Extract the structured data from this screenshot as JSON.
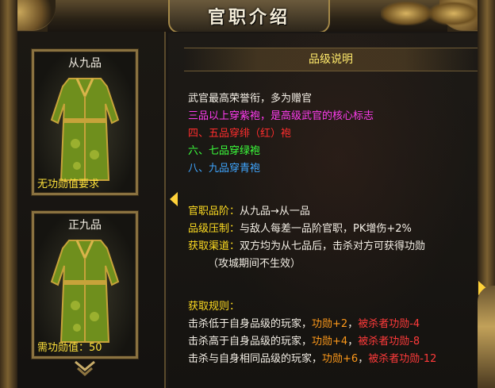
{
  "window": {
    "title": "官职介绍"
  },
  "ranks": [
    {
      "name": "从九品",
      "requirement": "无功勋值要求"
    },
    {
      "name": "正九品",
      "requirement": "需功勋值：50"
    }
  ],
  "panel": {
    "header": "品级说明",
    "desc_lines": [
      "武官最高荣誉衔，多为赠官",
      "三品以上穿紫袍，是高级武官的核心标志",
      "四、五品穿绯（红）袍",
      "六、七品穿绿袍",
      "八、九品穿青袍"
    ],
    "info": [
      {
        "label": "官职品阶：",
        "text": "从九品→从一品"
      },
      {
        "label": "品级压制：",
        "text": "与敌人每差一品阶官职，PK增伤+2%"
      },
      {
        "label": "获取渠道：",
        "text": "双方均为从七品后，击杀对方可获得功勋"
      }
    ],
    "info_note": "（攻城期间不生效）",
    "rules_title": "获取规则：",
    "rules": [
      {
        "text": "击杀低于自身品级的玩家，",
        "gain": "功勋+2",
        "sep": "，",
        "loss": "被杀者功勋-4"
      },
      {
        "text": "击杀高于自身品级的玩家，",
        "gain": "功勋+4",
        "sep": "，",
        "loss": "被杀者功勋-8"
      },
      {
        "text": "击杀与自身相同品级的玩家，",
        "gain": "功勋+6",
        "sep": "，",
        "loss": "被杀者功勋-12"
      }
    ]
  },
  "colors": {
    "gold": "#a48848",
    "yellow": "#ffdd22",
    "magenta": "#ff3cf0",
    "red": "#ff2d2d",
    "green": "#3bff3b",
    "blue": "#3fa6ff",
    "orange": "#ff9a1a"
  },
  "icons": [
    "scroll-down-chevron-icon",
    "arrow-right-icon",
    "arrow-left-icon",
    "robe-icon"
  ]
}
